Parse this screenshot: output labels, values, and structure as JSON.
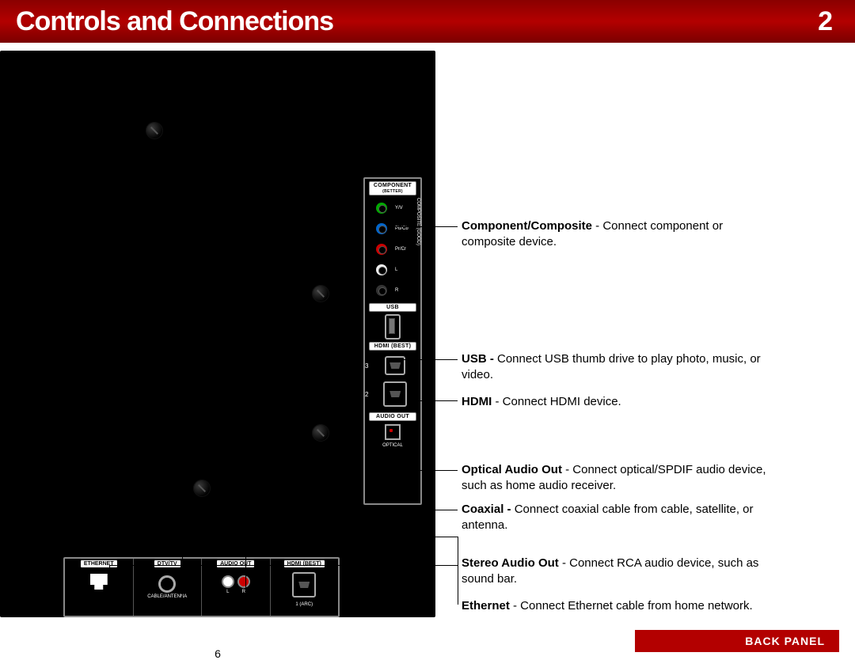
{
  "header": {
    "title": "Controls and Connections",
    "chapter": "2"
  },
  "side": {
    "component_label": "COMPONENT",
    "component_sub": "(BETTER)",
    "composite_side": "COMPOSITE (GOOD)",
    "jacks": {
      "y": "Y/V",
      "pb": "Pb/Cb",
      "pr": "Pr/Cr",
      "l": "L",
      "r": "R"
    },
    "usb_label": "USB",
    "hdmi_label": "HDMI (BEST)",
    "hdmi3": "3",
    "hdmi2": "2",
    "audio_out_label": "AUDIO OUT",
    "optical_label": "OPTICAL"
  },
  "bottom": {
    "ethernet": "ETHERNET",
    "dtv": "DTV/TV",
    "dtv_sub": "CABLE/ANTENNA",
    "audio_out": "AUDIO OUT",
    "l": "L",
    "r": "R",
    "hdmi": "HDMI (BEST)",
    "hdmi1": "1 (ARC)"
  },
  "desc": {
    "component": {
      "b": "Component/Composite",
      "t": " - Connect component or composite device."
    },
    "usb": {
      "b": "USB -",
      "t": " Connect USB thumb drive to play photo, music, or video."
    },
    "hdmi": {
      "b": "HDMI",
      "t": " - Connect HDMI device."
    },
    "optical": {
      "b": "Optical Audio Out",
      "t": " - Connect optical/SPDIF audio device, such as home audio receiver."
    },
    "coax": {
      "b": "Coaxial -",
      "t": " Connect coaxial cable from cable, satellite, or antenna."
    },
    "stereo": {
      "b": "Stereo Audio Out",
      "t": " - Connect RCA audio device, such as sound bar."
    },
    "eth": {
      "b": "Ethernet",
      "t": " - Connect Ethernet cable from home network."
    }
  },
  "footer": {
    "back_panel": "BACK PANEL",
    "page": "6"
  }
}
